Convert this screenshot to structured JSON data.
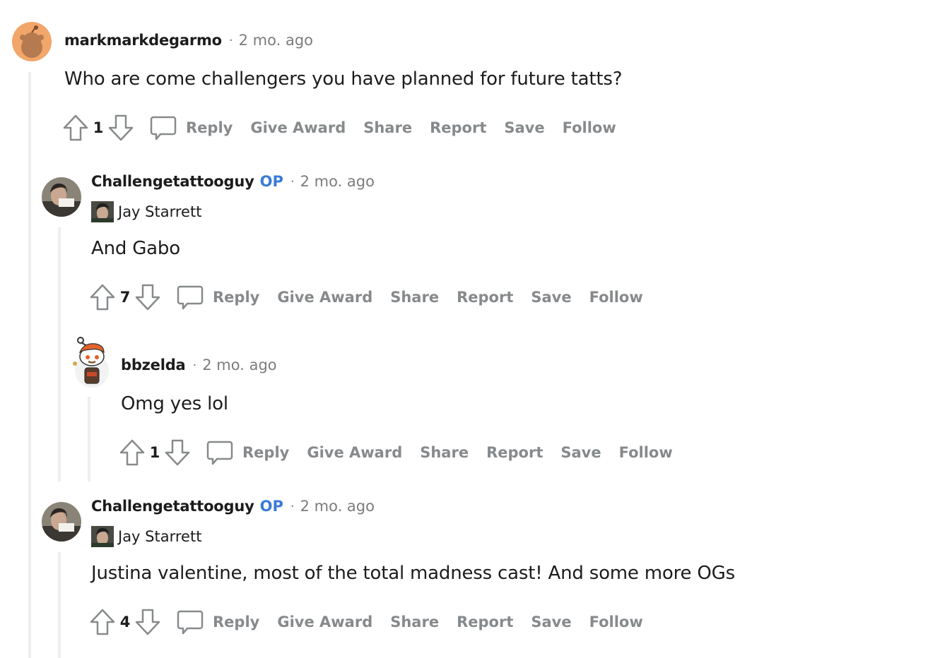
{
  "comments": [
    {
      "username": "markmarkdegarmo",
      "op_badge": "",
      "separator": "·",
      "time": "2 mo. ago",
      "flair": "",
      "body": "Who are come challengers you have planned for future tatts?",
      "score": "1",
      "actions": {
        "reply": "Reply",
        "award": "Give Award",
        "share": "Share",
        "report": "Report",
        "save": "Save",
        "follow": "Follow"
      }
    },
    {
      "username": "Challengetattooguy",
      "op_badge": "OP",
      "separator": "·",
      "time": "2 mo. ago",
      "flair": "Jay Starrett",
      "body": "And Gabo",
      "score": "7",
      "actions": {
        "reply": "Reply",
        "award": "Give Award",
        "share": "Share",
        "report": "Report",
        "save": "Save",
        "follow": "Follow"
      }
    },
    {
      "username": "bbzelda",
      "op_badge": "",
      "separator": "·",
      "time": "2 mo. ago",
      "flair": "",
      "body": "Omg yes lol",
      "score": "1",
      "actions": {
        "reply": "Reply",
        "award": "Give Award",
        "share": "Share",
        "report": "Report",
        "save": "Save",
        "follow": "Follow"
      }
    },
    {
      "username": "Challengetattooguy",
      "op_badge": "OP",
      "separator": "·",
      "time": "2 mo. ago",
      "flair": "Jay Starrett",
      "body": "Justina valentine, most of the total madness cast! And some more OGs",
      "score": "4",
      "actions": {
        "reply": "Reply",
        "award": "Give Award",
        "share": "Share",
        "report": "Report",
        "save": "Save",
        "follow": "Follow"
      }
    }
  ],
  "icons": {
    "upvote": "upvote-arrow-icon",
    "downvote": "downvote-arrow-icon",
    "reply": "comment-bubble-icon"
  },
  "colors": {
    "op_badge": "#3a7bd5",
    "action_text": "#878a8c",
    "thread_line": "#edeff1",
    "meta_text": "#7c7c7c"
  }
}
